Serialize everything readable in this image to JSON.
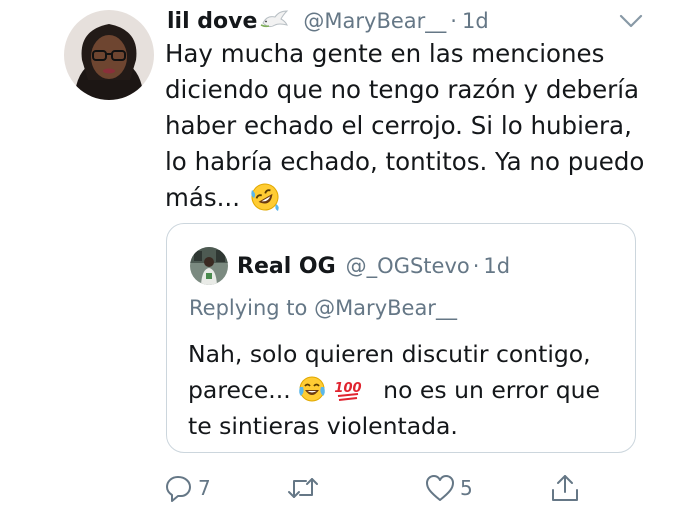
{
  "tweet": {
    "display_name": "lil dove",
    "name_emoji": "dove-emoji",
    "handle": "@MaryBear__",
    "separator": "·",
    "time": "1d",
    "text_lines": [
      "Hay mucha gente en las menciones",
      "diciendo que no tengo razón y debería",
      "haber echado el cerrojo. Si lo hubiera,",
      "lo habría echado, tontitos. Ya no puedo",
      "más..."
    ],
    "text_end_emoji": "rolling-on-floor-laughing-emoji"
  },
  "quoted_tweet": {
    "display_name": "Real OG",
    "handle": "@_OGStevo",
    "separator": "·",
    "time": "1d",
    "replying_to": "Replying to @MaryBear__",
    "text_line_1": "Nah, solo quieren discutir contigo,",
    "text_line_2_start": "parece...",
    "text_line_2_end": "no es un error que",
    "text_line_3": "te sintieras violentada.",
    "emojis": [
      "tears-of-joy-emoji",
      "hundred-points-emoji"
    ]
  },
  "actions": {
    "reply_count": "7",
    "retweet_count": "",
    "like_count": "5"
  },
  "colors": {
    "text": "#14171a",
    "secondary_text": "#657786",
    "border": "#ccd6dd",
    "background": "#ffffff"
  }
}
